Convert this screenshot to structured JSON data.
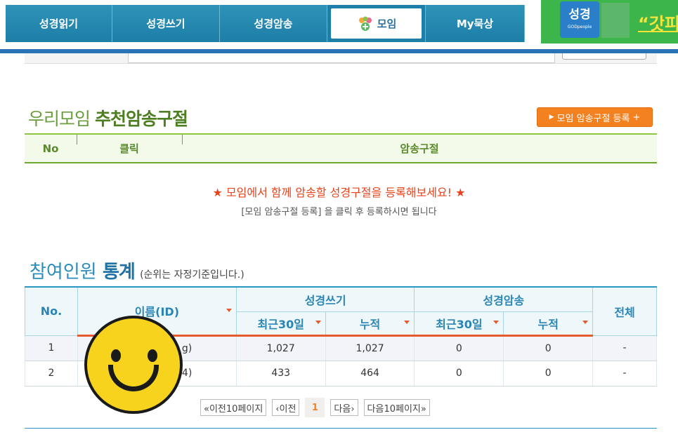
{
  "nav": {
    "tabs": [
      {
        "label": "성경읽기"
      },
      {
        "label": "성경쓰기"
      },
      {
        "label": "성경암송"
      },
      {
        "label": "모임",
        "icon": "people-group-icon",
        "active": true
      },
      {
        "label": "My묵상"
      }
    ]
  },
  "banner": {
    "logo_text": "성경",
    "logo_sub": "GODpeople",
    "headline": "“갓피"
  },
  "recommend": {
    "title_light": "우리모임 ",
    "title_bold": "추천암송구절",
    "register_button": "모임 암송구절 등록",
    "columns": {
      "no": "No",
      "click": "클릭",
      "verse": "암송구절"
    },
    "notice_main": "모임에서 함께 암송할 성경구절을 등록해보세요!",
    "notice_sub": "[모임 암송구절 등록] 을 클릭 후 등록하시면 됩니다"
  },
  "stats": {
    "title_light": "참여인원 ",
    "title_bold": "통계",
    "title_note": "(순위는 자정기준입니다.)",
    "headers": {
      "no": "No.",
      "name": "이름(ID)",
      "writing": "성경쓰기",
      "memorize": "성경암송",
      "total": "전체",
      "recent30": "최근30일",
      "cumulative": "누적"
    },
    "rows": [
      {
        "no": "1",
        "name_tail": "g)",
        "w_recent": "1,027",
        "w_cum": "1,027",
        "m_recent": "0",
        "m_cum": "0",
        "total": "-"
      },
      {
        "no": "2",
        "name_tail": "4)",
        "w_recent": "433",
        "w_cum": "464",
        "m_recent": "0",
        "m_cum": "0",
        "total": "-"
      }
    ]
  },
  "pager": {
    "prev10": "«이전10페이지",
    "prev": "‹이전",
    "current": "1",
    "next": "다음›",
    "next10": "다음10페이지»"
  },
  "colors": {
    "nav": "#1d7ea7",
    "green": "#6aab2e",
    "orange": "#f4811f",
    "red_notice": "#e8431c",
    "stat_blue": "#2a8dbd"
  }
}
